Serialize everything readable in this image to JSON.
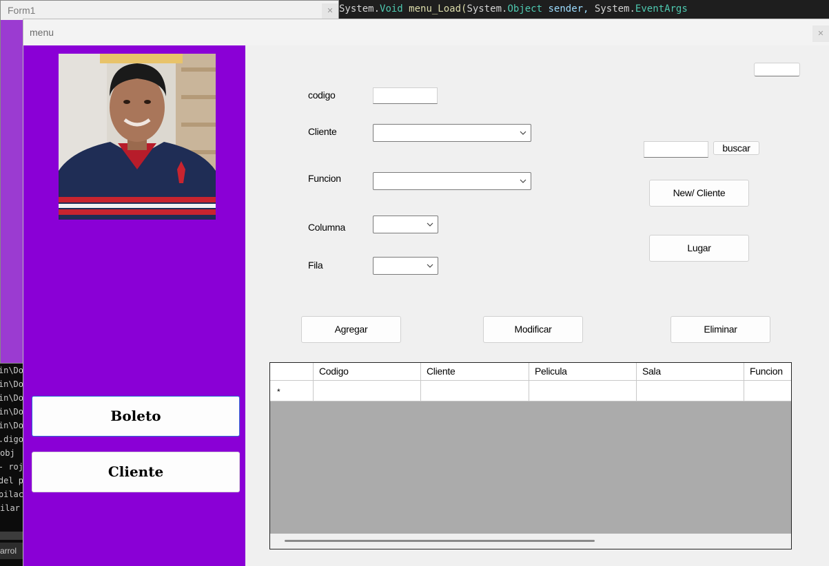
{
  "background": {
    "code_tokens": [
      {
        "text": "System.",
        "cls": ""
      },
      {
        "text": "Void",
        "cls": "kw"
      },
      {
        "text": " menu_Load(",
        "cls": "fn"
      },
      {
        "text": "System.",
        "cls": ""
      },
      {
        "text": "Object",
        "cls": "kw"
      },
      {
        "text": " sender, ",
        "cls": "id"
      },
      {
        "text": "System.",
        "cls": ""
      },
      {
        "text": "EventArgs",
        "cls": "kw"
      }
    ],
    "terminal_lines": [
      "in\\Do",
      "in\\Do",
      "in\\Do",
      "in\\Do",
      "in\\Do",
      "digo.",
      "obj",
      "roj -",
      "del p",
      "pilac",
      "ilar"
    ],
    "terminal_tab": "arrol"
  },
  "form1": {
    "title": "Form1",
    "close_glyph": "✕"
  },
  "window": {
    "title": "menu",
    "close_glyph": "✕"
  },
  "sidebar": {
    "color": "#8a00d6",
    "photo_alt": "user-photo",
    "buttons": [
      {
        "label": "Boleto",
        "active": true
      },
      {
        "label": "Cliente",
        "active": false
      }
    ]
  },
  "form": {
    "codigo_label": "codigo",
    "codigo_value": "",
    "cliente_label": "Cliente",
    "cliente_value": "",
    "funcion_label": "Funcion",
    "funcion_value": "",
    "columna_label": "Columna",
    "columna_value": "",
    "fila_label": "Fila",
    "fila_value": "",
    "top_right_value": "",
    "search_value": "",
    "buscar_label": "buscar",
    "new_cliente_label": "New/ Cliente",
    "lugar_label": "Lugar",
    "agregar_label": "Agregar",
    "modificar_label": "Modificar",
    "eliminar_label": "Eliminar"
  },
  "grid": {
    "columns": [
      "",
      "Codigo",
      "Cliente",
      "Pelicula",
      "Sala",
      "Funcion"
    ],
    "new_row_marker": "*"
  }
}
